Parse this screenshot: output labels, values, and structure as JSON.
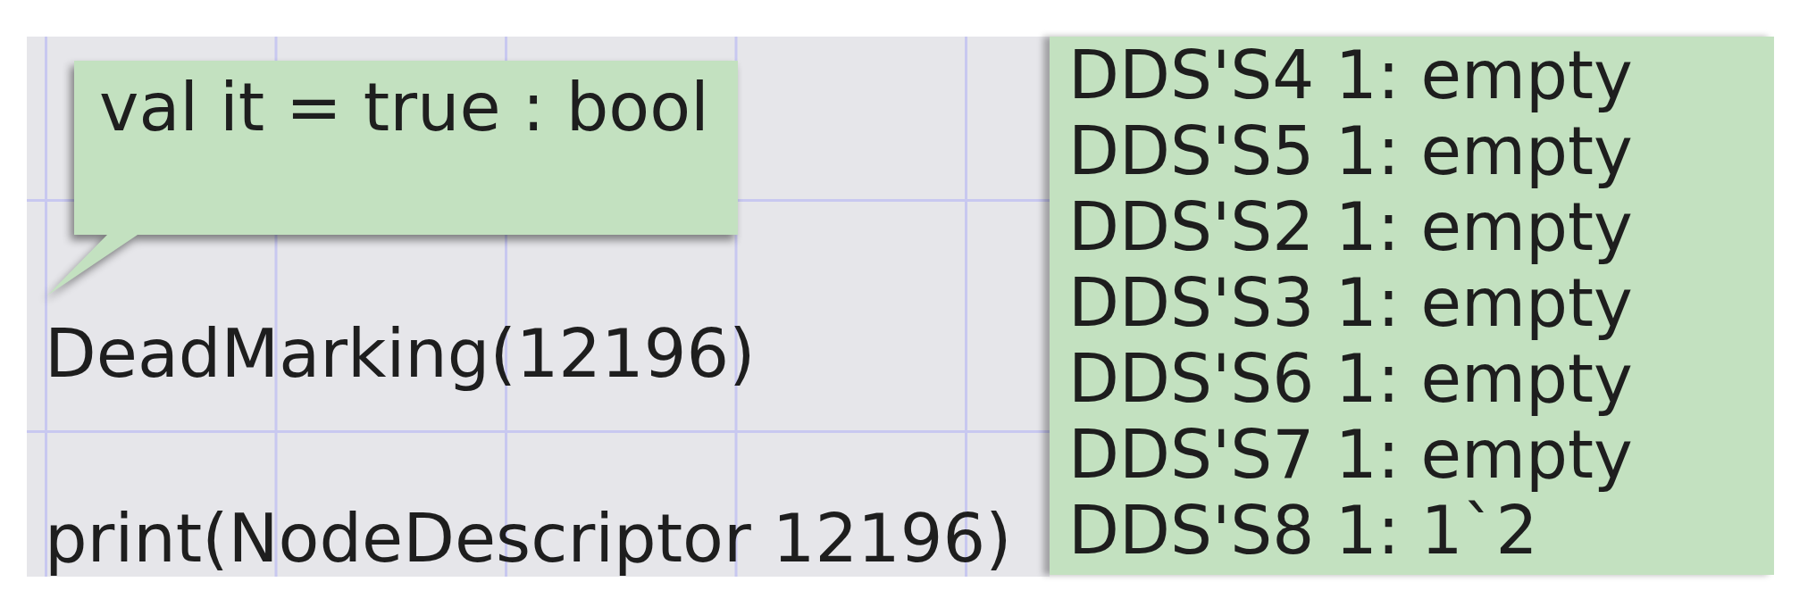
{
  "canvas": {
    "tooltip": {
      "text": "val it = true : bool"
    },
    "labels": [
      "DeadMarking(12196)",
      "print(NodeDescriptor 12196)"
    ]
  },
  "marking_panel": {
    "lines": [
      "DDS'S4 1: empty",
      "DDS'S5 1: empty",
      "DDS'S2 1: empty",
      "DDS'S3 1: empty",
      "DDS'S6 1: empty",
      "DDS'S7 1: empty",
      "DDS'S8 1: 1`2"
    ]
  }
}
